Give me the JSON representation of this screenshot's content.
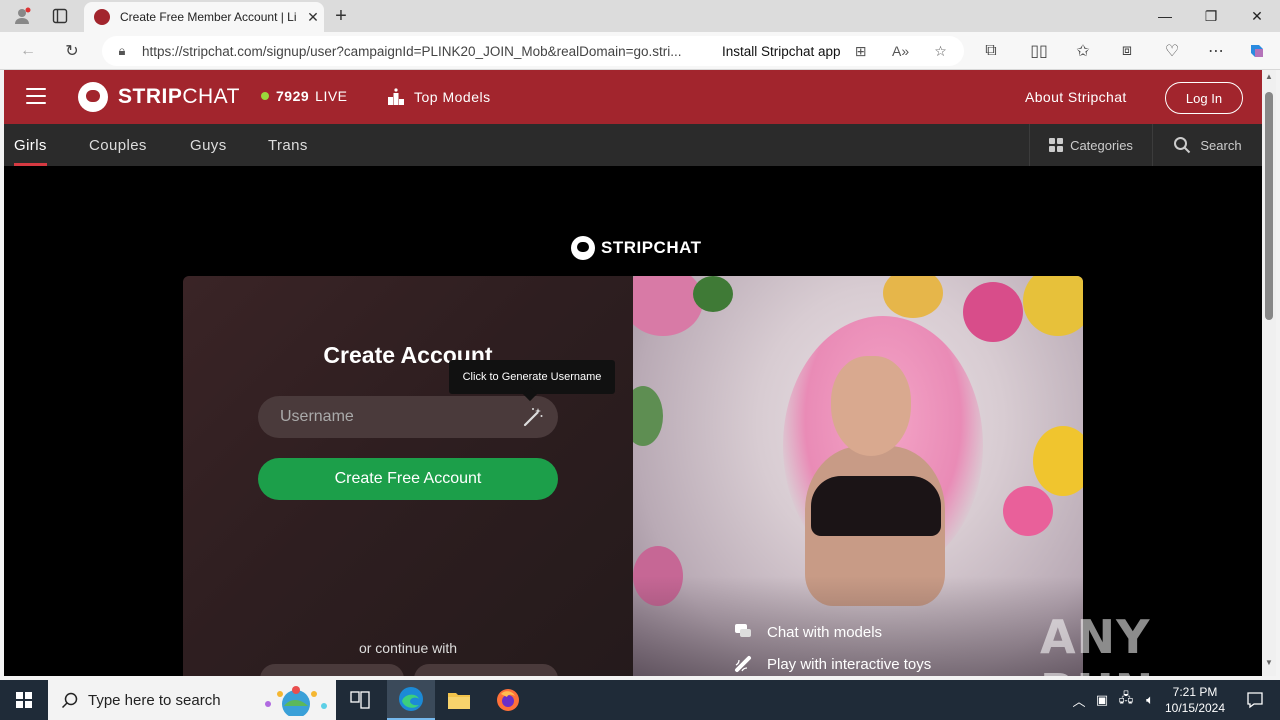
{
  "browser": {
    "tab_title": "Create Free Member Account | Li",
    "url": "https://stripchat.com/signup/user?campaignId=PLINK20_JOIN_Mob&realDomain=go.stri...",
    "install_app": "Install Stripchat app"
  },
  "site": {
    "brand_bold": "STRIP",
    "brand_light": "CHAT",
    "live_count": "7929",
    "live_label": "LIVE",
    "top_models": "Top Models",
    "about": "About Stripchat",
    "login": "Log In",
    "categories": [
      "Girls",
      "Couples",
      "Guys",
      "Trans"
    ],
    "active_category": "Girls",
    "categories_button": "Categories",
    "search_button": "Search"
  },
  "signup": {
    "center_brand": "STRIPCHAT",
    "title": "Create Account",
    "username_placeholder": "Username",
    "tooltip": "Click to Generate Username",
    "create_button": "Create Free Account",
    "continue_with": "or continue with",
    "features": [
      "Chat with models",
      "Play with interactive toys"
    ]
  },
  "watermark": "ANY RUN",
  "taskbar": {
    "search_placeholder": "Type here to search",
    "time": "7:21 PM",
    "date": "10/15/2024"
  },
  "colors": {
    "brand_red": "#a2252d",
    "cta_green": "#1c9f4a",
    "live_dot": "#9bd83b"
  }
}
